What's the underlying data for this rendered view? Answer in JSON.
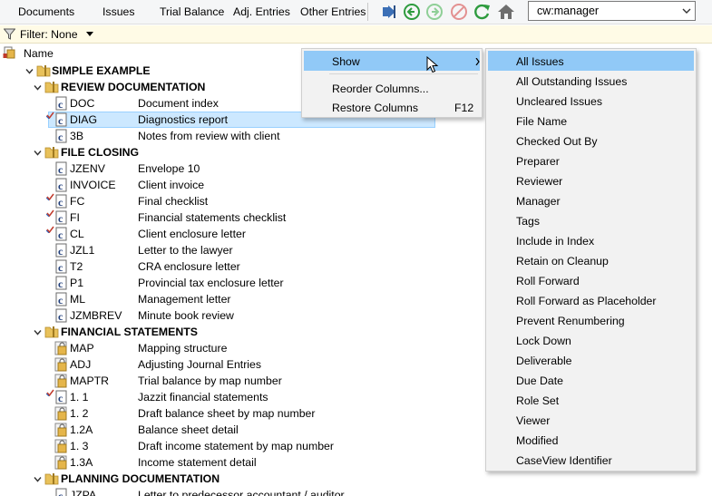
{
  "toolbar": {
    "tabs": [
      "Documents",
      "Issues",
      "Trial Balance",
      "Adj. Entries",
      "Other Entries"
    ],
    "icons": [
      "go-to-icon",
      "back-icon",
      "forward-icon",
      "stop-icon",
      "refresh-icon",
      "home-icon"
    ],
    "role_combo": {
      "value": "cw:manager"
    }
  },
  "filter": {
    "label": "Filter: None"
  },
  "header": {
    "name": "Name"
  },
  "tree": [
    {
      "type": "folder",
      "level": 0,
      "label": "SIMPLE EXAMPLE"
    },
    {
      "type": "folder",
      "level": 1,
      "label": "REVIEW DOCUMENTATION"
    },
    {
      "type": "doc",
      "code": "DOC",
      "desc": "Document index",
      "icon": "caseview",
      "check": false
    },
    {
      "type": "doc",
      "code": "DIAG",
      "desc": "Diagnostics report",
      "icon": "caseview",
      "check": true,
      "selected": true
    },
    {
      "type": "doc",
      "code": "3B",
      "desc": "Notes from review with client",
      "icon": "caseview",
      "check": false
    },
    {
      "type": "folder",
      "level": 1,
      "label": "FILE CLOSING"
    },
    {
      "type": "doc",
      "code": "JZENV",
      "desc": "Envelope 10",
      "icon": "caseview",
      "check": false
    },
    {
      "type": "doc",
      "code": "INVOICE",
      "desc": "Client invoice",
      "icon": "caseview",
      "check": false
    },
    {
      "type": "doc",
      "code": "FC",
      "desc": "Final checklist",
      "icon": "caseview",
      "check": true
    },
    {
      "type": "doc",
      "code": "FI",
      "desc": "Financial statements checklist",
      "icon": "caseview",
      "check": true
    },
    {
      "type": "doc",
      "code": "CL",
      "desc": "Client enclosure letter",
      "icon": "caseview",
      "check": true
    },
    {
      "type": "doc",
      "code": "JZL1",
      "desc": "Letter to the lawyer",
      "icon": "caseview",
      "check": false
    },
    {
      "type": "doc",
      "code": "T2",
      "desc": "CRA enclosure letter",
      "icon": "caseview",
      "check": false
    },
    {
      "type": "doc",
      "code": "P1",
      "desc": "Provincial tax enclosure letter",
      "icon": "caseview",
      "check": false
    },
    {
      "type": "doc",
      "code": "ML",
      "desc": "Management letter",
      "icon": "caseview",
      "check": false
    },
    {
      "type": "doc",
      "code": "JZMBREV",
      "desc": "Minute book review",
      "icon": "caseview",
      "check": false
    },
    {
      "type": "folder",
      "level": 1,
      "label": "FINANCIAL STATEMENTS"
    },
    {
      "type": "doc",
      "code": "MAP",
      "desc": "Mapping structure",
      "icon": "locked",
      "check": false
    },
    {
      "type": "doc",
      "code": "ADJ",
      "desc": "Adjusting Journal Entries",
      "icon": "locked",
      "check": false
    },
    {
      "type": "doc",
      "code": "MAPTR",
      "desc": "Trial balance by map number",
      "icon": "locked",
      "check": false
    },
    {
      "type": "doc",
      "code": "1. 1",
      "desc": "Jazzit financial statements",
      "icon": "caseview",
      "check": true
    },
    {
      "type": "doc",
      "code": "1. 2",
      "desc": "Draft balance sheet by map number",
      "icon": "locked",
      "check": false
    },
    {
      "type": "doc",
      "code": "1.2A",
      "desc": "Balance sheet detail",
      "icon": "locked",
      "check": false
    },
    {
      "type": "doc",
      "code": "1. 3",
      "desc": "Draft income statement by map number",
      "icon": "locked",
      "check": false
    },
    {
      "type": "doc",
      "code": "1.3A",
      "desc": "Income statement detail",
      "icon": "locked",
      "check": false
    },
    {
      "type": "folder",
      "level": 1,
      "label": "PLANNING DOCUMENTATION"
    },
    {
      "type": "doc",
      "code": "JZPA",
      "desc": "Letter to predecessor accountant / auditor",
      "icon": "caseview",
      "check": false
    }
  ],
  "context_menu": {
    "items": [
      {
        "label": "Show",
        "submenu": true,
        "highlighted": true
      },
      {
        "label": "Reorder Columns...",
        "shortcut": ""
      },
      {
        "label": "Restore Columns",
        "shortcut": "F12"
      }
    ]
  },
  "show_submenu": {
    "items": [
      "All Issues",
      "All Outstanding Issues",
      "Uncleared Issues",
      "File Name",
      "Checked Out By",
      "Preparer",
      "Reviewer",
      "Manager",
      "Tags",
      "Include in Index",
      "Retain on Cleanup",
      "Roll Forward",
      "Roll Forward as Placeholder",
      "Prevent Renumbering",
      "Lock Down",
      "Deliverable",
      "Due Date",
      "Role Set",
      "Viewer",
      "Modified",
      "CaseView Identifier"
    ],
    "highlighted": "All Issues"
  },
  "colors": {
    "selection": "#cce8ff",
    "menu_highlight": "#91c9f7",
    "filter_bg": "#fffbe6",
    "folder": "#e8c15a",
    "check": "#c0392b"
  }
}
